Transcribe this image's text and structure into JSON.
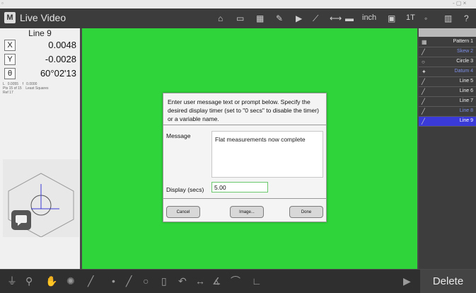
{
  "window": {
    "controls": "- ▢ ×"
  },
  "header": {
    "logo": "M",
    "title": "Live Video",
    "unit": "inch",
    "qty": "1T"
  },
  "left_panel": {
    "feature_name": "Line 9",
    "axes": [
      {
        "label": "X",
        "value": "0.0048"
      },
      {
        "label": "Y",
        "value": "-0.0028"
      },
      {
        "label": "θ",
        "value": "60°02'13"
      }
    ],
    "fit_info": [
      "L   0.0055    f   0.0000",
      "Pts 15 of 15    Least Squares",
      "Ref 17"
    ]
  },
  "right_panel": {
    "features": [
      {
        "label": "Pattern 1",
        "icon": "pattern-icon",
        "dim": false,
        "selected": false
      },
      {
        "label": "Skew 2",
        "icon": "line-icon",
        "dim": true,
        "selected": false
      },
      {
        "label": "Circle 3",
        "icon": "circle-icon",
        "dim": false,
        "selected": false
      },
      {
        "label": "Datum 4",
        "icon": "datum-icon",
        "dim": true,
        "selected": false
      },
      {
        "label": "Line 5",
        "icon": "line-icon",
        "dim": false,
        "selected": false
      },
      {
        "label": "Line 6",
        "icon": "line-icon",
        "dim": false,
        "selected": false
      },
      {
        "label": "Line 7",
        "icon": "line-icon",
        "dim": false,
        "selected": false
      },
      {
        "label": "Line 8",
        "icon": "line-icon",
        "dim": true,
        "selected": false
      },
      {
        "label": "Line 9",
        "icon": "line-icon",
        "dim": false,
        "selected": true
      }
    ]
  },
  "dialog": {
    "prompt": "Enter user message text or prompt below. Specify the desired display timer (set to \"0 secs\" to disable the timer) or a variable name.",
    "message_label": "Message",
    "message_value": "Flat measurements now complete",
    "secs_label": "Display (secs)",
    "secs_value": "5.00",
    "cancel_label": "Cancel",
    "image_label": "Image...",
    "done_label": "Done"
  },
  "bottombar": {
    "delete_label": "Delete"
  },
  "colors": {
    "video": "#2fd43a",
    "selection": "#3a3ad8"
  }
}
